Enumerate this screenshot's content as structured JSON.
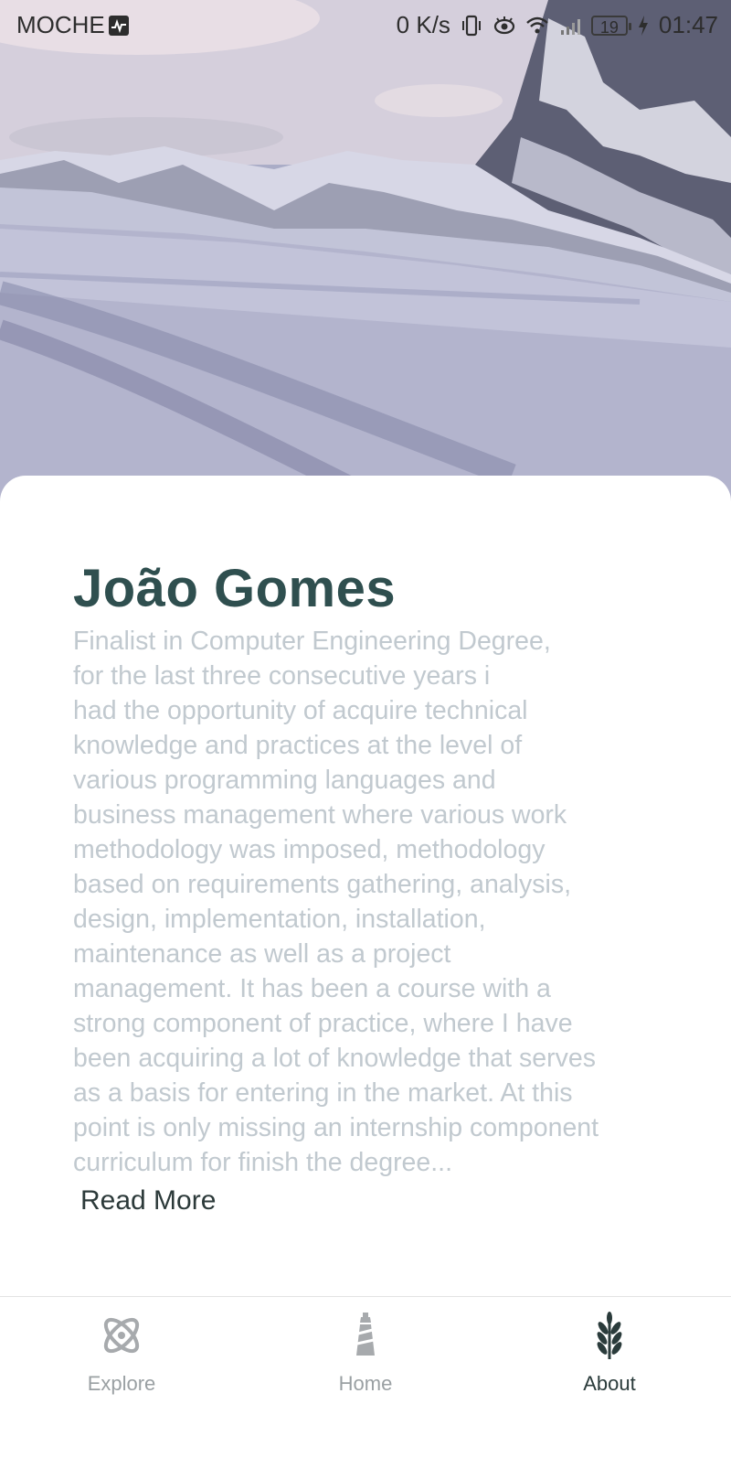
{
  "status_bar": {
    "carrier": "MOCHE",
    "network_speed": "0 K/s",
    "battery": "19",
    "time": "01:47",
    "icons": [
      "activity-icon",
      "vibrate-icon",
      "eye-icon",
      "wifi-icon",
      "signal-icon",
      "battery-icon",
      "charging-icon"
    ]
  },
  "hero": {
    "image": "snowy-mountain-landscape"
  },
  "profile": {
    "name": "João Gomes",
    "bio": "Finalist in Computer Engineering Degree,\nfor the last three consecutive years i\nhad the opportunity of acquire technical\nknowledge and practices at the level of\nvarious programming languages and\nbusiness management where various work\nmethodology was imposed, methodology\nbased on requirements gathering, analysis,\ndesign, implementation, installation,\nmaintenance as well as a project\nmanagement. It has been a course with a\nstrong component of practice, where I have\nbeen acquiring a lot of knowledge that serves\nas a basis for entering in the market. At this\npoint is only missing an internship component\ncurriculum for finish the degree...",
    "read_more_label": "Read More"
  },
  "bottom_nav": {
    "items": [
      {
        "label": "Explore",
        "icon": "atom-icon",
        "active": false
      },
      {
        "label": "Home",
        "icon": "lighthouse-icon",
        "active": false
      },
      {
        "label": "About",
        "icon": "wheat-icon",
        "active": true
      }
    ]
  },
  "colors": {
    "name": "#2f4f4f",
    "bio": "#c1c9cf",
    "nav_active": "#2a3b3b",
    "nav_inactive": "#9aa0a3"
  }
}
